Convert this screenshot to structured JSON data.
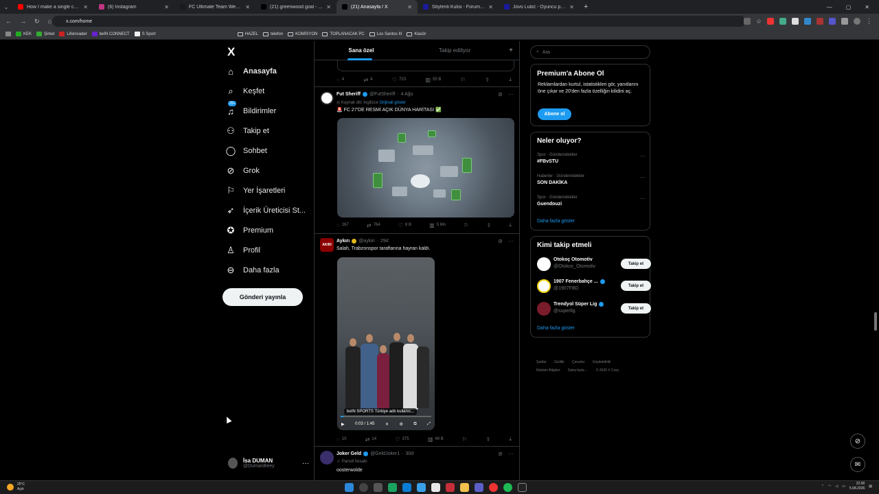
{
  "browser": {
    "tabs": [
      {
        "title": "How I make a single coffee eve",
        "color": "#ff0000"
      },
      {
        "title": "(6) Instagram",
        "color": "#c13584"
      },
      {
        "title": "FC Ultimate Team Web App - E",
        "color": "#1a1a1a"
      },
      {
        "title": "(21) greenwood goal - Arama /",
        "color": "#000000"
      },
      {
        "title": "(21) Anasayfa / X",
        "color": "#000000"
      },
      {
        "title": "Söylenti Kulisi - Forum | Transf",
        "color": "#1a1aa0"
      },
      {
        "title": "Jovo Lukić - Oyuncu profili 26/2",
        "color": "#1a1aa0"
      }
    ],
    "active_tab": 4,
    "url": "x.com/home",
    "bookmarks": [
      "KEK",
      "Şirket",
      "Lifeinvader",
      "beIN CONNECT",
      "S Sport",
      "HAZEL",
      "telefon",
      "KOMİSYON",
      "TOPLANACAK PC",
      "Los Santos III",
      "Klasör"
    ]
  },
  "nav": {
    "logo": "X",
    "items": [
      {
        "label": "Anasayfa",
        "icon": "home-icon",
        "glyph": "⌂"
      },
      {
        "label": "Keşfet",
        "icon": "search-icon",
        "glyph": "⌕"
      },
      {
        "label": "Bildirimler",
        "icon": "bell-icon",
        "glyph": "♫",
        "badge": "20+"
      },
      {
        "label": "Takip et",
        "icon": "person-add-icon",
        "glyph": "⚇"
      },
      {
        "label": "Sohbet",
        "icon": "chat-icon",
        "glyph": "◯"
      },
      {
        "label": "Grok",
        "icon": "grok-icon",
        "glyph": "⊘"
      },
      {
        "label": "Yer İşaretleri",
        "icon": "bookmark-icon",
        "glyph": "⚐"
      },
      {
        "label": "İçerik Üreticisi St...",
        "icon": "rocket-icon",
        "glyph": "➶"
      },
      {
        "label": "Premium",
        "icon": "premium-icon",
        "glyph": "✪"
      },
      {
        "label": "Profil",
        "icon": "profile-icon",
        "glyph": "♙"
      },
      {
        "label": "Daha fazla",
        "icon": "more-icon",
        "glyph": "⊖"
      }
    ],
    "post_button": "Gönderi yayınla",
    "user": {
      "name": "İsa DUMAN",
      "handle": "@DumanBeey"
    }
  },
  "feed": {
    "tabs": [
      "Sana özel",
      "Takip ediliyor"
    ],
    "top_actions": {
      "replies": "4",
      "reposts": "4",
      "likes": "723",
      "views": "55 B"
    },
    "tweets": [
      {
        "name": "Fut Sheriff",
        "handle": "@FutSheriff",
        "time": "4 Ağu",
        "lang_note": "Kaynak dili: İngilizce",
        "lang_link": "Orijinali göster",
        "text": "🚨 FC 27'DE RESMİ AÇIK DÜNYA HARİTASI ✅",
        "replies": "267",
        "reposts": "764",
        "likes": "8 B",
        "views": "5 Mn"
      },
      {
        "name": "Aykırı",
        "handle": "@aykiri",
        "time": "29d",
        "text": "Salah, Trabzonspor taraftarına hayran kaldı.",
        "video_label": "beIN SPORTS Türkiye adlı kullanıc...",
        "video_time": "0:03 / 1:45",
        "progress": 0.03,
        "replies": "10",
        "reposts": "14",
        "likes": "375",
        "views": "48 B"
      },
      {
        "name": "Joker Geld",
        "handle": "@GeldJoker1",
        "time": "30d",
        "note": "Parodi hesabı",
        "text": "oosterwolde"
      }
    ]
  },
  "right": {
    "search_placeholder": "Ara",
    "premium": {
      "title": "Premium'a Abone Ol",
      "text": "Reklamlardan kurtul, istatistikleri gör, yanıtlarını öne çıkar ve 20'den fazla özelliğin kilidini aç.",
      "button": "Abone ol"
    },
    "trends": {
      "title": "Neler oluyor?",
      "items": [
        {
          "category": "Spor · Gündemdekiler",
          "name": "#FBvSTU"
        },
        {
          "category": "Haberler · Gündemdekiler",
          "name": "SON DAKİKA"
        },
        {
          "category": "Spor · Gündemdekiler",
          "name": "Guendouzi"
        }
      ],
      "more": "Daha fazla göster"
    },
    "who_to_follow": {
      "title": "Kimi takip etmeli",
      "items": [
        {
          "name": "Otokoç Otomotiv",
          "handle": "@Otokoc_Otomotiv",
          "button": "Takip et",
          "verified": "gold"
        },
        {
          "name": "1907 Fenerbahçe ...",
          "handle": "@1907FBD",
          "button": "Takip et",
          "verified": "blue"
        },
        {
          "name": "Trendyol Süper Lig",
          "handle": "@superlig",
          "button": "Takip et",
          "verified": "blue"
        }
      ],
      "more": "Daha fazla göster"
    },
    "footer": [
      "Şartlar",
      "Gizlilik",
      "Çerezler",
      "Erişilebilirlik",
      "Reklam Bilgileri",
      "Daha fazla ...",
      "© 2026 X Corp."
    ]
  },
  "taskbar": {
    "temp": "25°C",
    "weather": "Açık",
    "time": "22:00",
    "date": "5.08.2026"
  },
  "colors": {
    "accent": "#1d9bf0",
    "gold": "#e2b719",
    "bg": "#000000"
  }
}
